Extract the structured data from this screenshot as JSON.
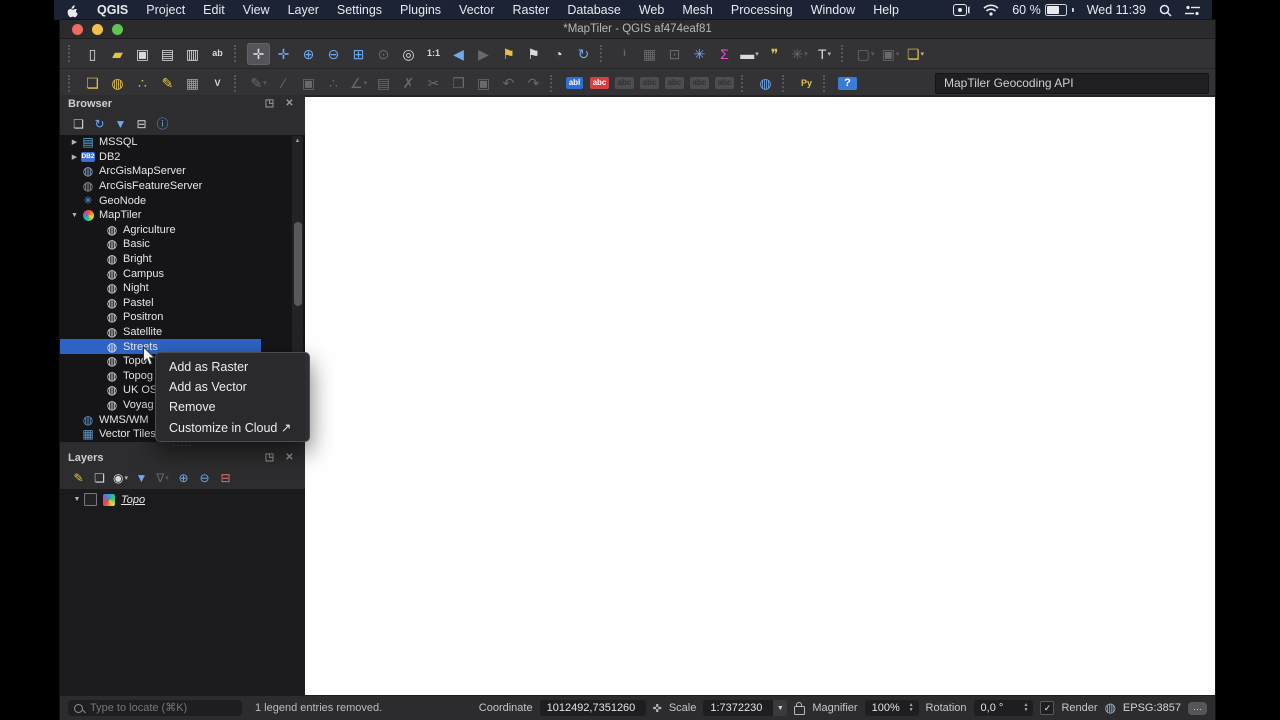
{
  "menubar": {
    "items": [
      "QGIS",
      "Project",
      "Edit",
      "View",
      "Layer",
      "Settings",
      "Plugins",
      "Vector",
      "Raster",
      "Database",
      "Web",
      "Mesh",
      "Processing",
      "Window",
      "Help"
    ],
    "battery": "60 %",
    "clock": "Wed 11:39"
  },
  "window": {
    "title": "*MapTiler - QGIS af474eaf81"
  },
  "toolbar1": [
    {
      "sep": true
    },
    {
      "n": "new-project-button",
      "g": "▯",
      "c": "gw"
    },
    {
      "n": "open-project-button",
      "g": "▰",
      "c": "gy"
    },
    {
      "n": "save-project-button",
      "g": "▣",
      "c": "gw"
    },
    {
      "n": "new-print-layout-button",
      "g": "▤",
      "c": "gw"
    },
    {
      "n": "layout-manager-button",
      "g": "▥",
      "c": "gw"
    },
    {
      "n": "style-manager-button",
      "g": "ab",
      "c": "gw sm"
    },
    {
      "sep": true
    },
    {
      "n": "pan-map-button",
      "g": "✛",
      "c": "gw",
      "active": true
    },
    {
      "n": "pan-to-selection-button",
      "g": "✛",
      "c": "gb"
    },
    {
      "n": "zoom-in-button",
      "g": "⊕",
      "c": "gb"
    },
    {
      "n": "zoom-out-button",
      "g": "⊖",
      "c": "gb"
    },
    {
      "n": "zoom-full-button",
      "g": "⊞",
      "c": "gb"
    },
    {
      "n": "zoom-to-selection-button",
      "g": "⊙",
      "c": "gw",
      "dim": true
    },
    {
      "n": "zoom-to-layer-button",
      "g": "◎",
      "c": "gw"
    },
    {
      "n": "zoom-native-button",
      "g": "1:1",
      "c": "gw sm"
    },
    {
      "n": "zoom-last-button",
      "g": "◀",
      "c": "gb"
    },
    {
      "n": "zoom-next-button",
      "g": "▶",
      "c": "gw",
      "dim": true
    },
    {
      "n": "new-bookmark-button",
      "g": "⚑",
      "c": "gy"
    },
    {
      "n": "show-bookmarks-button",
      "g": "⚑",
      "c": "gw"
    },
    {
      "n": "temporal-controller-button",
      "g": "◔",
      "c": "gw"
    },
    {
      "n": "refresh-map-button",
      "g": "↻",
      "c": "gb"
    },
    {
      "sep": true
    },
    {
      "n": "identify-features-button",
      "g": "i",
      "c": "gw sm",
      "dim": true
    },
    {
      "n": "open-attribute-table-button",
      "g": "▦",
      "c": "gw",
      "dim": true
    },
    {
      "n": "field-calculator-button",
      "g": "⊡",
      "c": "gw",
      "dim": true
    },
    {
      "n": "processing-toolbox-button",
      "g": "✳",
      "c": "gb"
    },
    {
      "n": "statistics-button",
      "g": "Σ",
      "c": "gm"
    },
    {
      "n": "measure-button",
      "g": "▬",
      "c": "gw",
      "dd": true
    },
    {
      "n": "map-tips-button",
      "g": "❞",
      "c": "gy"
    },
    {
      "n": "run-feature-action-button",
      "g": "✳",
      "c": "gw",
      "dim": true,
      "dd": true
    },
    {
      "n": "text-annotation-button",
      "g": "T",
      "c": "gw",
      "dd": true
    },
    {
      "sep": true
    },
    {
      "n": "select-features-button",
      "g": "▢",
      "c": "gw",
      "dim": true,
      "dd": true
    },
    {
      "n": "deselect-features-button",
      "g": "▣",
      "c": "gw",
      "dim": true,
      "dd": true
    },
    {
      "n": "layer-visibility-button",
      "g": "❏",
      "c": "gy",
      "dd": true
    }
  ],
  "toolbar2": [
    {
      "sep": true
    },
    {
      "n": "data-source-manager-button",
      "g": "❏",
      "c": "gy"
    },
    {
      "n": "new-geopackage-layer-button",
      "g": "◍",
      "c": "gy"
    },
    {
      "n": "new-shapefile-layer-button",
      "g": "∴",
      "c": "gy"
    },
    {
      "n": "new-spatialite-layer-button",
      "g": "✎",
      "c": "gy"
    },
    {
      "n": "new-temporary-scratch-layer-button",
      "g": "▦",
      "c": "gb"
    },
    {
      "n": "new-virtual-layer-button",
      "g": "V",
      "c": "gw sm"
    },
    {
      "sep": true
    },
    {
      "n": "current-edits-button",
      "g": "✎",
      "c": "gw",
      "dim": true,
      "dd": true
    },
    {
      "n": "toggle-editing-button",
      "g": "∕",
      "c": "gw",
      "dim": true
    },
    {
      "n": "save-layer-edits-button",
      "g": "▣",
      "c": "gw",
      "dim": true
    },
    {
      "n": "digitize-button",
      "g": "∴",
      "c": "gw",
      "dim": true
    },
    {
      "n": "advanced-digitizing-button",
      "g": "∠",
      "c": "gw",
      "dim": true,
      "dd": true
    },
    {
      "n": "modify-attributes-button",
      "g": "▤",
      "c": "gw",
      "dim": true
    },
    {
      "n": "delete-selected-button",
      "g": "✗",
      "c": "gw",
      "dim": true
    },
    {
      "n": "cut-features-button",
      "g": "✂",
      "c": "gw",
      "dim": true
    },
    {
      "n": "copy-features-button",
      "g": "❐",
      "c": "gw",
      "dim": true
    },
    {
      "n": "paste-features-button",
      "g": "▣",
      "c": "gw",
      "dim": true
    },
    {
      "n": "undo-button",
      "g": "↶",
      "c": "gw",
      "dim": true
    },
    {
      "n": "redo-button",
      "g": "↷",
      "c": "gw",
      "dim": true
    },
    {
      "sep": true
    },
    {
      "n": "layer-labeling-button",
      "g": "abl",
      "c": "chipb"
    },
    {
      "n": "layer-diagram-button",
      "g": "abc",
      "c": "chipr"
    },
    {
      "n": "pin-labels-button",
      "g": "abc",
      "c": "chipg",
      "dim": true
    },
    {
      "n": "highlight-labels-button",
      "g": "abc",
      "c": "chipg",
      "dim": true
    },
    {
      "n": "move-label-button",
      "g": "abc",
      "c": "chipg",
      "dim": true
    },
    {
      "n": "rotate-label-button",
      "g": "abc",
      "c": "chipg",
      "dim": true
    },
    {
      "n": "change-label-button",
      "g": "abc",
      "c": "chipg",
      "dim": true
    },
    {
      "sep": true
    },
    {
      "n": "metasearch-button",
      "g": "◍",
      "c": "gb"
    },
    {
      "sep": true
    },
    {
      "n": "python-console-button",
      "g": "Py",
      "c": "gy sm"
    },
    {
      "sep": true
    },
    {
      "n": "whats-this-button",
      "g": "?",
      "c": "chiph"
    }
  ],
  "geocoder": {
    "value": "MapTiler Geocoding API"
  },
  "panel_buttons": [
    {
      "n": "float-panel-button",
      "g": "◳"
    },
    {
      "n": "close-panel-button",
      "g": "✕"
    }
  ],
  "browser": {
    "title": "Browser",
    "toolbar": [
      {
        "n": "add-selected-layers-button",
        "g": "❏",
        "c": "gw"
      },
      {
        "n": "refresh-browser-button",
        "g": "↻",
        "c": "gb"
      },
      {
        "n": "filter-browser-button",
        "g": "▼",
        "c": "gb"
      },
      {
        "n": "collapse-all-button",
        "g": "⊟",
        "c": "gw"
      },
      {
        "n": "properties-widget-button",
        "g": "ⓘ",
        "c": "gb"
      }
    ],
    "tree": [
      {
        "label": "MSSQL",
        "ar": "c",
        "g": "▤",
        "c": "ic-mssql"
      },
      {
        "label": "DB2",
        "ar": "c",
        "g": "DB2",
        "c": "ic-db2"
      },
      {
        "label": "ArcGisMapServer",
        "g": "◍",
        "c": "ic-ags"
      },
      {
        "label": "ArcGisFeatureServer",
        "g": "◍",
        "c": "ic-agf"
      },
      {
        "label": "GeoNode",
        "g": "✳",
        "c": "ic-geo"
      },
      {
        "label": "MapTiler",
        "ar": "o",
        "g": "",
        "c": "ic-mt"
      },
      {
        "label": "Agriculture",
        "lv": 1,
        "g": "◍",
        "c": "ic-globe"
      },
      {
        "label": "Basic",
        "lv": 1,
        "g": "◍",
        "c": "ic-globe"
      },
      {
        "label": "Bright",
        "lv": 1,
        "g": "◍",
        "c": "ic-globe"
      },
      {
        "label": "Campus",
        "lv": 1,
        "g": "◍",
        "c": "ic-globe"
      },
      {
        "label": "Night",
        "lv": 1,
        "g": "◍",
        "c": "ic-globe"
      },
      {
        "label": "Pastel",
        "lv": 1,
        "g": "◍",
        "c": "ic-globe"
      },
      {
        "label": "Positron",
        "lv": 1,
        "g": "◍",
        "c": "ic-globe"
      },
      {
        "label": "Satellite",
        "lv": 1,
        "g": "◍",
        "c": "ic-globe"
      },
      {
        "label": "Streets",
        "lv": 1,
        "g": "◍",
        "c": "ic-globe",
        "sel": true
      },
      {
        "label": "Topo",
        "lv": 1,
        "g": "◍",
        "c": "ic-globe"
      },
      {
        "label": "Topog",
        "lv": 1,
        "g": "◍",
        "c": "ic-globe"
      },
      {
        "label": "UK OS",
        "lv": 1,
        "g": "◍",
        "c": "ic-globe"
      },
      {
        "label": "Voyag",
        "lv": 1,
        "g": "◍",
        "c": "ic-globe"
      },
      {
        "label": "WMS/WM",
        "g": "◍",
        "c": "ic-wms"
      },
      {
        "label": "Vector Tiles",
        "g": "▦",
        "c": "ic-vt"
      }
    ]
  },
  "context_menu": {
    "items": [
      "Add as Raster",
      "Add as Vector",
      "Remove",
      "Customize in Cloud ↗"
    ]
  },
  "layers": {
    "title": "Layers",
    "toolbar": [
      {
        "n": "open-layer-styling-button",
        "g": "✎",
        "c": "gy"
      },
      {
        "n": "add-group-button",
        "g": "❏",
        "c": "gw"
      },
      {
        "n": "manage-map-themes-button",
        "g": "◉",
        "c": "gw",
        "dd": true
      },
      {
        "n": "filter-legend-button",
        "g": "▼",
        "c": "gb"
      },
      {
        "n": "filter-by-expression-button",
        "g": "∇",
        "c": "gw",
        "dim": true,
        "dd": true
      },
      {
        "n": "expand-all-button",
        "g": "⊕",
        "c": "gb"
      },
      {
        "n": "collapse-all-layers-button",
        "g": "⊖",
        "c": "gb"
      },
      {
        "n": "remove-layer-button",
        "g": "⊟",
        "c": "gr"
      }
    ],
    "items": [
      {
        "label": "Topo"
      }
    ]
  },
  "statusbar": {
    "locate_placeholder": "Type to locate (⌘K)",
    "message": "1 legend entries removed.",
    "coordinate_label": "Coordinate",
    "coordinate_value": "1012492,7351260",
    "scale_label": "Scale",
    "scale_value": "1:7372230",
    "magnifier_label": "Magnifier",
    "magnifier_value": "100%",
    "rotation_label": "Rotation",
    "rotation_value": "0,0 °",
    "render_label": "Render",
    "render_check": "✓",
    "crs": "EPSG:3857"
  }
}
